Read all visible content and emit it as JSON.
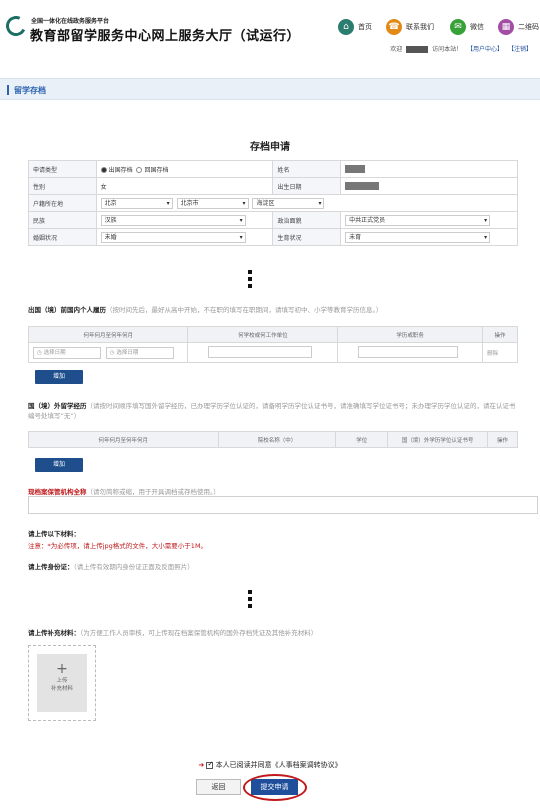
{
  "header": {
    "platform_small": "全国一体化在线政务服务平台",
    "site_title": "教育部留学服务中心网上服务大厅（试运行）",
    "nav": [
      {
        "label": "首页",
        "icon": "home-icon",
        "color": "#2b7d6f"
      },
      {
        "label": "联系我们",
        "icon": "contact-icon",
        "color": "#e28a17"
      },
      {
        "label": "微信",
        "icon": "wechat-icon",
        "color": "#39a13a"
      },
      {
        "label": "二维码",
        "icon": "qrcode-icon",
        "color": "#a34ea5"
      }
    ],
    "welcome": "欢迎",
    "welcome_suffix": "访问本站！",
    "user_center": "【用户中心】",
    "logout": "【注销】"
  },
  "section": {
    "title": "留学存档"
  },
  "form": {
    "title": "存档申请",
    "fields": {
      "apply_type_label": "申请类型",
      "apply_type_opt1": "出国存档",
      "apply_type_opt2": "回国存档",
      "name_label": "姓名",
      "gender_label": "性别",
      "gender_value": "女",
      "birth_label": "出生日期",
      "hukou_label": "户籍所在地",
      "hukou_province": "北京",
      "hukou_city": "北京市",
      "hukou_district": "海淀区",
      "ethnicity_label": "民族",
      "ethnicity_value": "汉族",
      "political_label": "政治面貌",
      "political_value": "中共正式党员",
      "marital_label": "婚姻状况",
      "marital_value": "未婚",
      "fertility_label": "生育状况",
      "fertility_value": "未育"
    }
  },
  "resume": {
    "label": "出国（境）前国内个人履历",
    "hint": "（按时间先后，最好从高中开始，不在职的填写在职期间，请填写初中、小学等教育学历信息。）",
    "columns": [
      "何年何月至何年何月",
      "何学校或何工作单位",
      "学历或职务",
      "操作"
    ],
    "row": {
      "start_placeholder": "选择日期",
      "end_placeholder": "选择日期",
      "action": "删除"
    },
    "add_button": "增加"
  },
  "overseas": {
    "label": "国（境）外留学经历",
    "hint": "（请按时间顺序填写国外留学经历，已办理学历学位认证的，请备明学历学位认证书号，请准确填写学位证书号；未办理学历学位认证的，请在认证书编号处填写“无”）",
    "columns": [
      "何年何月至何年何月",
      "院校名称（中）",
      "学位",
      "国（境）外学历学位认证书号",
      "操作"
    ],
    "add_button": "增加"
  },
  "agency": {
    "label": "现档案保管机构全称",
    "hint": "（请勿简称或缩，用于开具调档或存档使用。）"
  },
  "upload": {
    "title": "请上传以下材料：",
    "note": "注意：*为必传项，请上传jpg格式的文件，大小需要小于1M。",
    "id_label": "请上传身份证：",
    "id_hint": "（请上传有效期内身份证正面及反面照片）",
    "extra_label": "请上传补充材料：",
    "extra_hint": "（为方便工作人员审核，可上传现在档案保管机构的国外存档凭证及其他补充材料）",
    "box_plus": "+",
    "box_text1": "上传",
    "box_text2": "补充材料"
  },
  "footer": {
    "agree_text": "本人已阅读并同意《人事档案调转协议》",
    "cancel": "返回",
    "submit": "提交申请"
  },
  "colors": {
    "accent": "#1f4e9b",
    "highlight": "#c0191c",
    "section": "#2b63b1"
  }
}
